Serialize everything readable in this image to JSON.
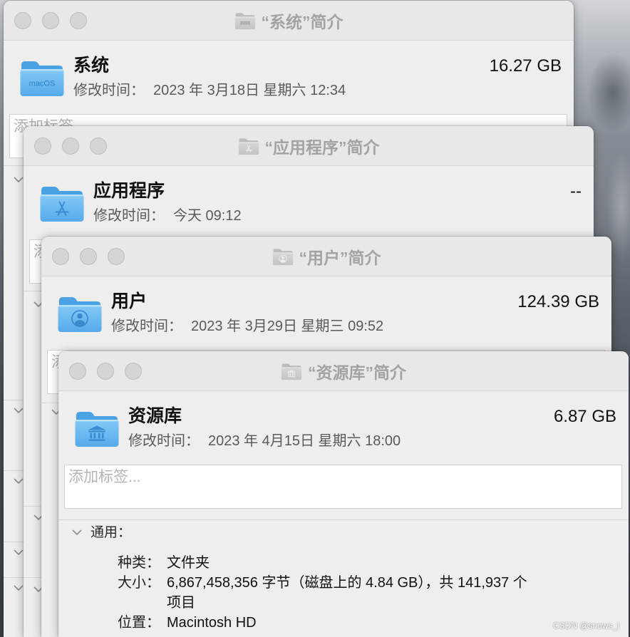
{
  "colors": {
    "folder_blue": "#58abeb",
    "folder_glyph": "#2f7fc4",
    "window_titlebar": "#e8e8e8",
    "window_body": "#eeeeee",
    "title_text": "#a3a3a3",
    "traffic_light_inactive": "#d5d5d5"
  },
  "windows": [
    {
      "title": "“系统”简介",
      "icon": "macos-folder-icon",
      "icon_label": "macOS",
      "name": "系统",
      "size": "16.27 GB",
      "modified_label": "修改时间：",
      "modified_value": "2023 年 3月18日 星期六 12:34",
      "tags_placeholder": "添加标签..."
    },
    {
      "title": "“应用程序”简介",
      "icon": "applications-folder-icon",
      "name": "应用程序",
      "size": "--",
      "modified_label": "修改时间：",
      "modified_value": "今天 09:12",
      "tags_placeholder": "添加标签..."
    },
    {
      "title": "“用户”简介",
      "icon": "users-folder-icon",
      "name": "用户",
      "size": "124.39 GB",
      "modified_label": "修改时间：",
      "modified_value": "2023 年 3月29日 星期三 09:52",
      "tags_placeholder": "添加标签..."
    },
    {
      "title": "“资源库”简介",
      "icon": "library-folder-icon",
      "name": "资源库",
      "size": "6.87 GB",
      "modified_label": "修改时间：",
      "modified_value": "2023 年 4月15日 星期六 18:00",
      "tags_placeholder": "添加标签..."
    }
  ],
  "general": {
    "section_label": "通用：",
    "kind_label": "种类：",
    "kind_value": "文件夹",
    "size_label": "大小：",
    "size_value_lines": [
      "6,867,458,356 字节（磁盘上的 4.84 GB），共 141,937 个",
      "项目"
    ],
    "location_label": "位置：",
    "location_value": "Macintosh HD"
  },
  "watermark": "CSDN @snows_l"
}
